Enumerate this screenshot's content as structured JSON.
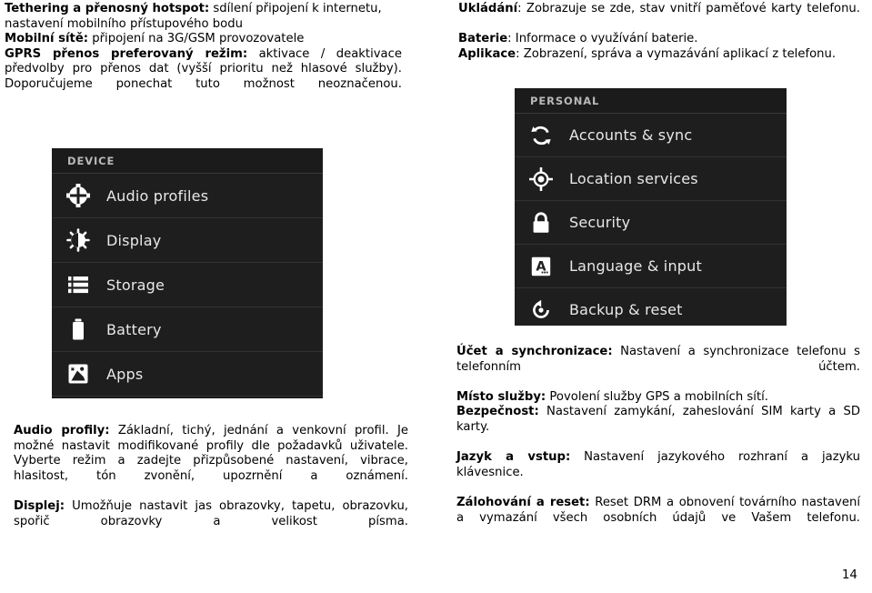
{
  "page_number": "14",
  "top_left_text": {
    "paragraphs": [
      {
        "lead": "Tethering a přenosný hotspot:",
        "body": " sdílení připojení k internetu, nastavení mobilního přístupového bodu",
        "justify": false
      },
      {
        "lead": "Mobilní sítě:",
        "body": " připojení na 3G/GSM provozovatele",
        "justify": false
      },
      {
        "lead": "GPRS přenos preferovaný režim:",
        "body": " aktivace / deaktivace předvolby pro přenos dat (vyšší prioritu než hlasové služby). Doporučujeme ponechat tuto možnost neoznačenou.",
        "justify": true
      }
    ]
  },
  "top_right_text": {
    "paragraphs": [
      {
        "lead": "Ukládání",
        "body": ": Zobrazuje se zde, stav vnitří paměťové karty telefonu.",
        "justify": true
      },
      {
        "lead": "Baterie",
        "body": ": Informace o využívání baterie.",
        "justify": false
      },
      {
        "lead": "Aplikace",
        "body": ": Zobrazení, správa a vymazávání aplikací z telefonu.",
        "justify": false
      }
    ]
  },
  "bottom_left_text": {
    "paragraphs": [
      {
        "lead": "Audio profily:",
        "body": " Základní, tichý, jednání a venkovní profil. Je možné nastavit modifikované profily dle požadavků uživatele. Vyberte režim a zadejte přizpůsobené nastavení, vibrace, hlasitost, tón zvonění, upozrnění a oznámení.",
        "justify": true
      },
      {
        "lead": "Displej:",
        "body": " Umožňuje nastavit jas obrazovky, tapetu, obrazovku, spořič obrazovky a velikost písma.",
        "justify": true
      }
    ]
  },
  "bottom_right_text": {
    "paragraphs": [
      {
        "lead": "Účet a synchronizace:",
        "body": " Nastavení a synchronizace telefonu s telefonním účtem.",
        "justify": true
      },
      {
        "lead": "Místo služby:",
        "body": " Povolení služby GPS a mobilních sítí.",
        "justify": false
      },
      {
        "lead": "Bezpečnost:",
        "body": " Nastavení zamykání, zaheslování SIM karty a SD karty.",
        "justify": true
      },
      {
        "lead": "Jazyk a vstup:",
        "body": " Nastavení jazykového rozhraní a jazyku klávesnice.",
        "justify": true
      },
      {
        "lead": "Zálohování a reset:",
        "body": " Reset DRM a obnovení továrního nastavení a vymazání všech osobních údajů ve Vašem telefonu.",
        "justify": true
      }
    ]
  },
  "device_screenshot": {
    "header": "DEVICE",
    "rows": [
      {
        "label": "Audio profiles",
        "icon": "audio-profiles-icon"
      },
      {
        "label": "Display",
        "icon": "display-brightness-icon"
      },
      {
        "label": "Storage",
        "icon": "storage-icon"
      },
      {
        "label": "Battery",
        "icon": "battery-icon"
      },
      {
        "label": "Apps",
        "icon": "apps-icon"
      }
    ]
  },
  "personal_screenshot": {
    "header": "PERSONAL",
    "rows": [
      {
        "label": "Accounts & sync",
        "icon": "sync-icon"
      },
      {
        "label": "Location services",
        "icon": "location-crosshair-icon"
      },
      {
        "label": "Security",
        "icon": "lock-icon"
      },
      {
        "label": "Language & input",
        "icon": "language-keyboard-icon"
      },
      {
        "label": "Backup & reset",
        "icon": "backup-reset-icon"
      }
    ]
  },
  "colors": {
    "page_background": "#ffffff",
    "text": "#000000",
    "screenshot_background": "#1b1b1b",
    "screenshot_row_background": "#1e1e1e",
    "screenshot_divider": "#323232",
    "screenshot_header_text": "#b9b9b9",
    "screenshot_row_text": "#e8e8e8",
    "icon_fill": "#ffffff"
  }
}
